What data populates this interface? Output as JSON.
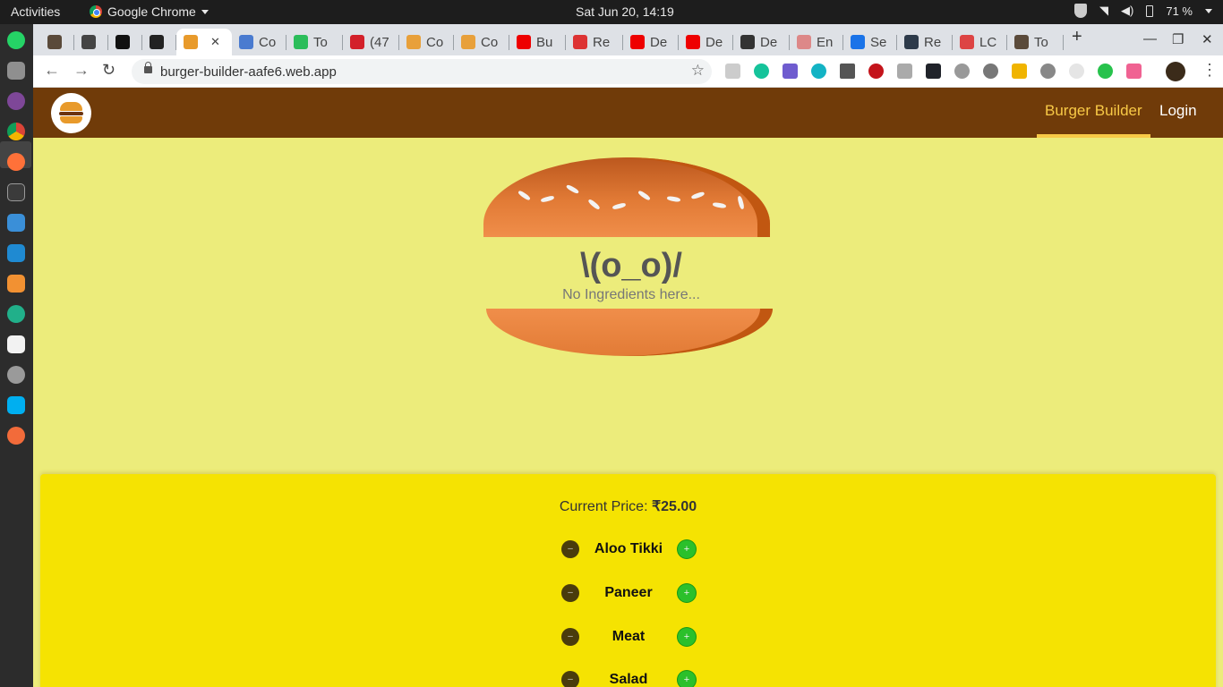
{
  "os": {
    "activities": "Activities",
    "app_name": "Google Chrome",
    "clock": "Sat Jun 20, 14:19",
    "battery": "71 %"
  },
  "browser": {
    "tabs": [
      {
        "label": ""
      },
      {
        "label": ""
      },
      {
        "label": ""
      },
      {
        "label": ""
      },
      {
        "label": "",
        "active": true
      },
      {
        "label": "Co"
      },
      {
        "label": "To"
      },
      {
        "label": "(47"
      },
      {
        "label": "Co"
      },
      {
        "label": "Co"
      },
      {
        "label": "Bu"
      },
      {
        "label": "Re"
      },
      {
        "label": "De"
      },
      {
        "label": "De"
      },
      {
        "label": "De"
      },
      {
        "label": "En"
      },
      {
        "label": "Se"
      },
      {
        "label": "Re"
      },
      {
        "label": "LC"
      },
      {
        "label": "To"
      }
    ],
    "new_tab": "+",
    "url": "burger-builder-aafe6.web.app"
  },
  "app": {
    "nav": {
      "burger_builder": "Burger Builder",
      "login": "Login"
    },
    "burger": {
      "kaomoji": "\\(o_o)/",
      "empty_message": "No Ingredients here..."
    },
    "controls": {
      "price_label": "Current Price:",
      "price_value": "₹25.00",
      "ingredients": [
        {
          "label": "Aloo Tikki"
        },
        {
          "label": "Paneer"
        },
        {
          "label": "Meat"
        },
        {
          "label": "Salad"
        }
      ]
    }
  },
  "colors": {
    "page_bg": "#ecec7b",
    "nav_bg": "#703b09",
    "nav_active": "#f8c946",
    "controls_bg": "#f5e302",
    "bread": "#e27b36"
  }
}
